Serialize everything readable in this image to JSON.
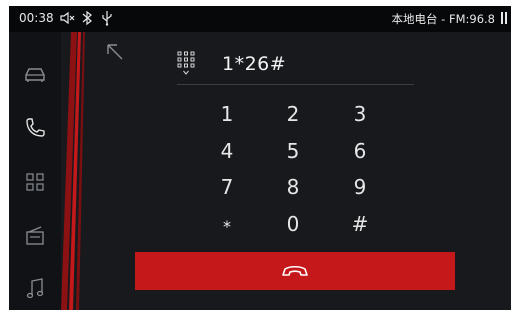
{
  "status_bar": {
    "time": "00:38",
    "icons": [
      "mute-icon",
      "bluetooth-icon",
      "usb-icon"
    ],
    "radio_info": "本地电台 - FM:96.8",
    "media_state": "pause-icon"
  },
  "sidebar": {
    "items": [
      {
        "name": "car",
        "icon": "car-icon"
      },
      {
        "name": "phone",
        "icon": "phone-icon",
        "active": true
      },
      {
        "name": "apps",
        "icon": "grid-icon"
      },
      {
        "name": "radio",
        "icon": "radio-icon"
      },
      {
        "name": "music",
        "icon": "music-note-icon"
      }
    ]
  },
  "dialer": {
    "input_value": "1*26#",
    "keys": [
      "1",
      "2",
      "3",
      "4",
      "5",
      "6",
      "7",
      "8",
      "9",
      "*",
      "0",
      "#"
    ],
    "end_call_icon": "hang-up-icon"
  },
  "colors": {
    "accent": "#c4181b",
    "background": "#17191d",
    "sidebar": "#101215",
    "status_bar": "#07080a"
  }
}
